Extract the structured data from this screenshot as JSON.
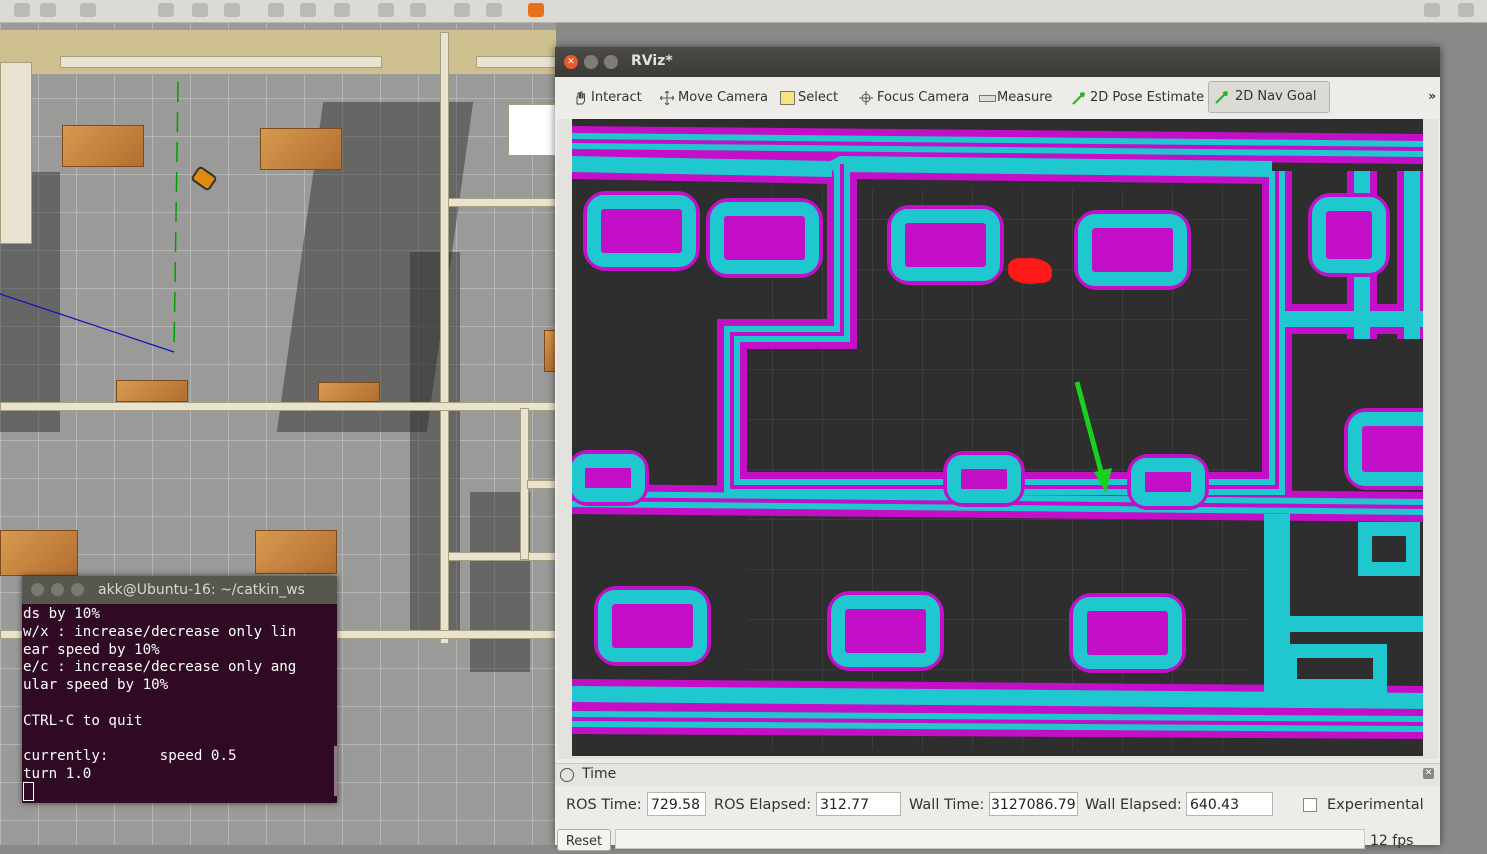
{
  "terminal": {
    "title": "akk@Ubuntu-16: ~/catkin_ws",
    "lines": [
      "ds by 10%",
      "w/x : increase/decrease only lin",
      "ear speed by 10%",
      "e/c : increase/decrease only ang",
      "ular speed by 10%",
      "",
      "CTRL-C to quit",
      "",
      "currently:      speed 0.5",
      "turn 1.0"
    ]
  },
  "rviz": {
    "title": "RViz*",
    "tools": [
      {
        "label": "Interact",
        "icon": "hand-icon"
      },
      {
        "label": "Move Camera",
        "icon": "move-camera-icon"
      },
      {
        "label": "Select",
        "icon": "select-icon"
      },
      {
        "label": "Focus Camera",
        "icon": "focus-camera-icon"
      },
      {
        "label": "Measure",
        "icon": "ruler-icon"
      },
      {
        "label": "2D Pose Estimate",
        "icon": "green-arrow-icon"
      },
      {
        "label": "2D Nav Goal",
        "icon": "green-arrow-icon",
        "active": true
      }
    ],
    "more_label": "»",
    "time_panel": {
      "title": "Time",
      "ros_time_label": "ROS Time:",
      "ros_time": "729.58",
      "ros_elapsed_label": "ROS Elapsed:",
      "ros_elapsed": "312.77",
      "wall_time_label": "Wall Time:",
      "wall_time": "3127086.79",
      "wall_elapsed_label": "Wall Elapsed:",
      "wall_elapsed": "640.43",
      "experimental_label": "Experimental",
      "experimental_checked": false
    },
    "reset_label": "Reset",
    "fps": "12 fps"
  },
  "colors": {
    "costmap_cyan": "#1fc8cf",
    "costmap_magenta": "#c40fc9",
    "costmap_background": "#2e2e2e",
    "goal_arrow": "#19d020",
    "terminal_bg": "#300a24",
    "close_button": "#e45a2a"
  }
}
